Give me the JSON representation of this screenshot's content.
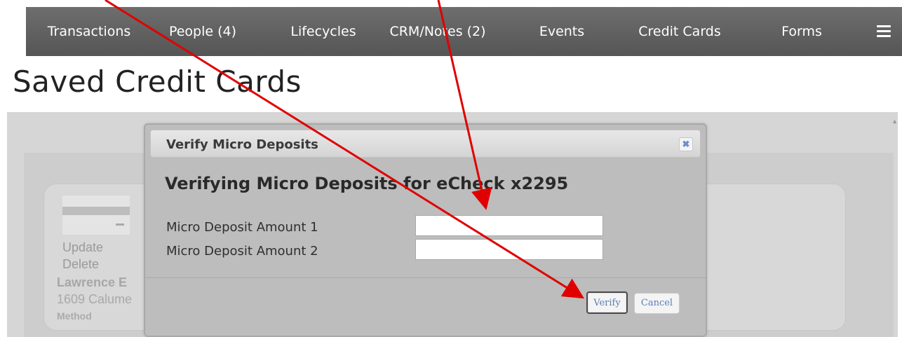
{
  "nav": {
    "items": [
      "Transactions",
      "People (4)",
      "Lifecycles",
      "CRM/Notes (2)",
      "Events",
      "Credit Cards",
      "Forms"
    ],
    "menu_icon": "hamburger-menu-icon"
  },
  "page": {
    "title": "Saved Credit Cards"
  },
  "card": {
    "update_label": "Update",
    "delete_label": "Delete",
    "name": "Lawrence E",
    "address": "1609 Calume",
    "method_label": "Method"
  },
  "modal": {
    "title": "Verify Micro Deposits",
    "close_icon": "close-x-icon",
    "heading": "Verifying Micro Deposits for eCheck x2295",
    "field1_label": "Micro Deposit Amount 1",
    "field1_value": "",
    "field2_label": "Micro Deposit Amount 2",
    "field2_value": "",
    "verify_label": "Verify",
    "cancel_label": "Cancel"
  },
  "colors": {
    "navbar": "#5e5e5e",
    "annotation_arrow": "#e00000",
    "link_blue": "#5a7fb5"
  }
}
